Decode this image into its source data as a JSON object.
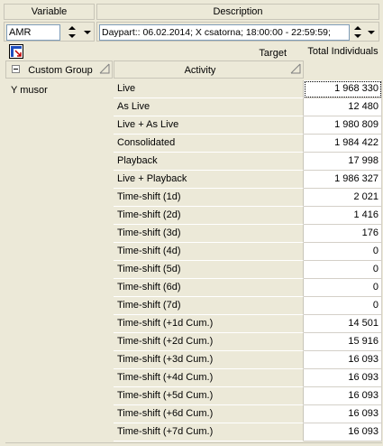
{
  "selector": {
    "variable_header": "Variable",
    "variable_value": "AMR",
    "description_header": "Description",
    "description_value": "Daypart:: 06.02.2014; X csatorna; 18:00:00 - 22:59:59;"
  },
  "toolbar": {
    "tool_icon": "pivot-grid-icon",
    "target_label": "Target",
    "target_value": "Total Individuals"
  },
  "grid": {
    "group_header": "Custom Group",
    "activity_header": "Activity",
    "group_value": "Y musor",
    "rows": [
      {
        "activity": "Live",
        "value": "1 968 330"
      },
      {
        "activity": "As Live",
        "value": "12 480"
      },
      {
        "activity": "Live + As Live",
        "value": "1 980 809"
      },
      {
        "activity": "Consolidated",
        "value": "1 984 422"
      },
      {
        "activity": "Playback",
        "value": "17 998"
      },
      {
        "activity": "Live + Playback",
        "value": "1 986 327"
      },
      {
        "activity": "Time-shift (1d)",
        "value": "2 021"
      },
      {
        "activity": "Time-shift (2d)",
        "value": "1 416"
      },
      {
        "activity": "Time-shift (3d)",
        "value": "176"
      },
      {
        "activity": "Time-shift (4d)",
        "value": "0"
      },
      {
        "activity": "Time-shift (5d)",
        "value": "0"
      },
      {
        "activity": "Time-shift (6d)",
        "value": "0"
      },
      {
        "activity": "Time-shift (7d)",
        "value": "0"
      },
      {
        "activity": "Time-shift (+1d Cum.)",
        "value": "14 501"
      },
      {
        "activity": "Time-shift (+2d Cum.)",
        "value": "15 916"
      },
      {
        "activity": "Time-shift (+3d Cum.)",
        "value": "16 093"
      },
      {
        "activity": "Time-shift (+4d Cum.)",
        "value": "16 093"
      },
      {
        "activity": "Time-shift (+5d Cum.)",
        "value": "16 093"
      },
      {
        "activity": "Time-shift (+6d Cum.)",
        "value": "16 093"
      },
      {
        "activity": "Time-shift (+7d Cum.)",
        "value": "16 093"
      }
    ]
  }
}
